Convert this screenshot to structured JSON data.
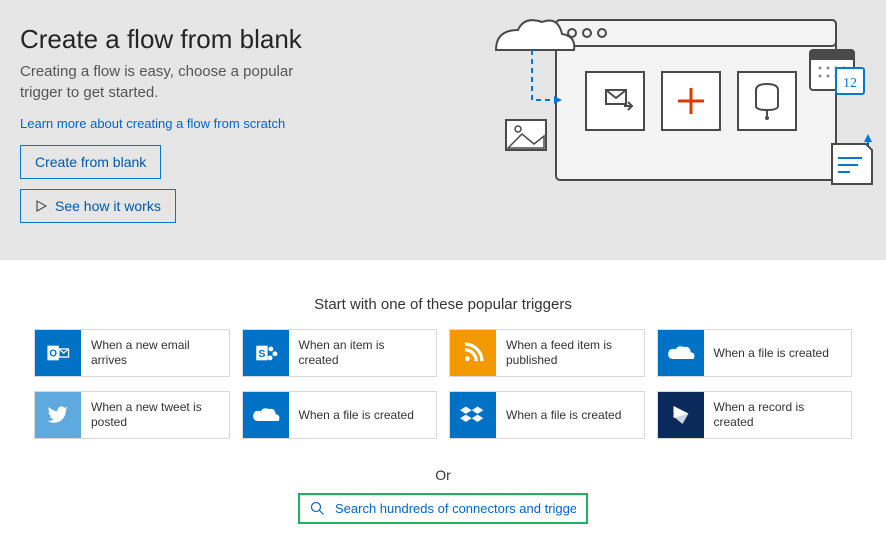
{
  "hero": {
    "title": "Create a flow from blank",
    "subtitle": "Creating a flow is easy, choose a popular trigger to get started.",
    "learn_link": "Learn more about creating a flow from scratch",
    "create_btn": "Create from blank",
    "howitworks_btn": "See how it works"
  },
  "section_title": "Start with one of these popular triggers",
  "triggers": [
    {
      "id": "outlook",
      "label": "When a new email arrives",
      "color": "c-outlook"
    },
    {
      "id": "sharepoint",
      "label": "When an item is created",
      "color": "c-sp"
    },
    {
      "id": "rss",
      "label": "When a feed item is published",
      "color": "c-rss"
    },
    {
      "id": "onedrive",
      "label": "When a file is created",
      "color": "c-od"
    },
    {
      "id": "twitter",
      "label": "When a new tweet is posted",
      "color": "c-tw"
    },
    {
      "id": "onedrive2",
      "label": "When a file is created",
      "color": "c-od2"
    },
    {
      "id": "dropbox",
      "label": "When a file is created",
      "color": "c-db"
    },
    {
      "id": "dynamics",
      "label": "When a record is created",
      "color": "c-dyn"
    }
  ],
  "or_label": "Or",
  "search": {
    "placeholder": "Search hundreds of connectors and triggers"
  },
  "calendar_day": "12"
}
